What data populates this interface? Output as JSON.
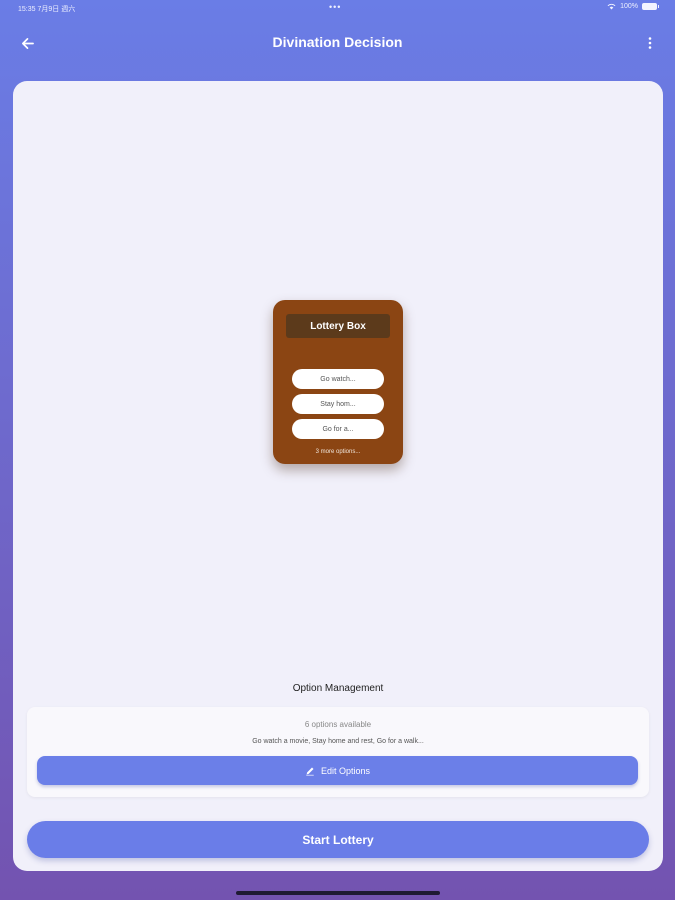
{
  "status_bar": {
    "time": "15:35  7月9日 週六",
    "dots": "•••",
    "battery_text": "100%",
    "icons": [
      "wifi-icon",
      "battery-icon"
    ]
  },
  "app_bar": {
    "title": "Divination Decision",
    "back_icon": "back-arrow-icon",
    "more_icon": "more-vertical-icon"
  },
  "lottery_box": {
    "title": "Lottery Box",
    "options": [
      "Go watch...",
      "Stay hom...",
      "Go for a..."
    ],
    "more_text": "3 more options..."
  },
  "option_management": {
    "title": "Option Management",
    "count_text": "6 options available",
    "summary_text": "Go watch a movie, Stay home and rest, Go for a walk...",
    "edit_button_label": "Edit Options",
    "edit_icon": "pencil-icon"
  },
  "start_button_label": "Start Lottery",
  "colors": {
    "gradient_top": "#6a7de6",
    "gradient_bottom": "#7353b0",
    "card_background": "#f1f0fa",
    "lottery_box": "#8b4513",
    "lottery_title_plate": "#5c3a1b",
    "accent": "#6b7fe8"
  }
}
